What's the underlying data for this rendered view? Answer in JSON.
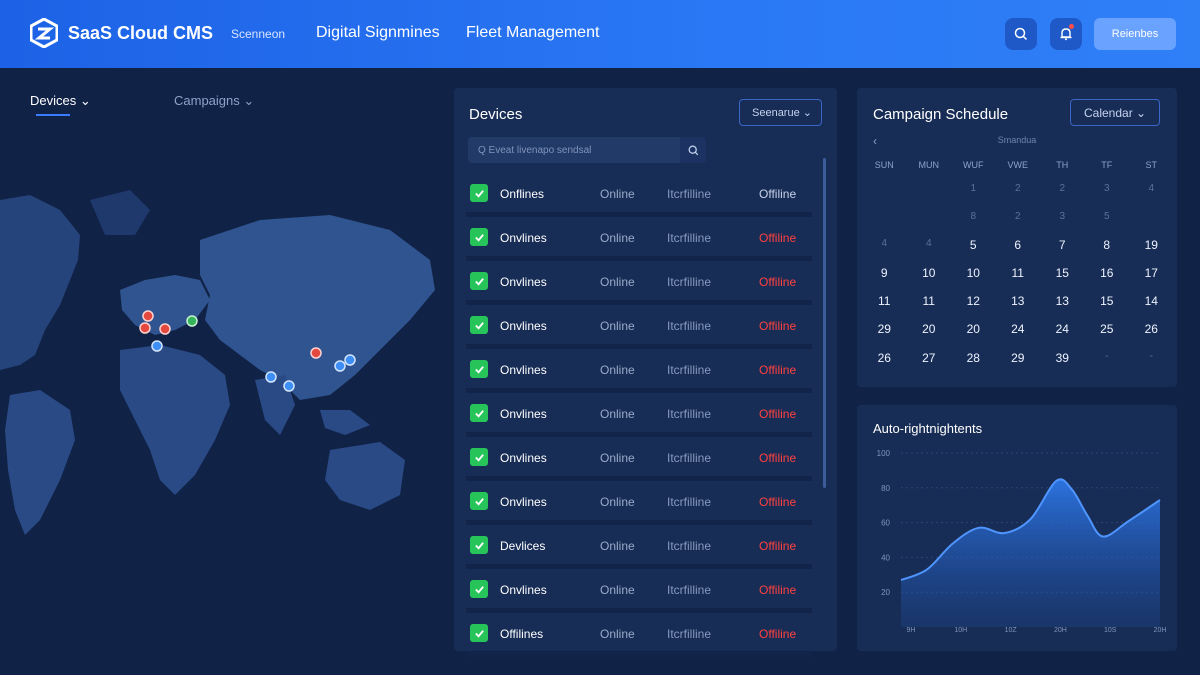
{
  "header": {
    "brand": "SaaS Cloud CMS",
    "nav": [
      "Scenneon",
      "Digital Signmines",
      "Fleet Management"
    ],
    "search_icon": "search-icon",
    "bell_icon": "bell-icon",
    "button_label": "Reienbes"
  },
  "left": {
    "tab_devices": "Devices ⌄",
    "tab_campaigns": "Campaigns ⌄",
    "markers": {
      "red": "#e5483f",
      "blue": "#3d8ef5",
      "green": "#35b45a"
    }
  },
  "devices": {
    "title": "Devices",
    "select_label": "Seenarue ⌄",
    "search_placeholder": "Q Eveat livenapo sendsal",
    "rows": [
      {
        "name": "Onflines",
        "col2": "Online",
        "col3": "Itcrfilline",
        "status": "Offiline",
        "red": false
      },
      {
        "name": "Onvlines",
        "col2": "Online",
        "col3": "Itcrfilline",
        "status": "Offiline",
        "red": true
      },
      {
        "name": "Onvlines",
        "col2": "Online",
        "col3": "Itcrfilline",
        "status": "Offiline",
        "red": true
      },
      {
        "name": "Onvlines",
        "col2": "Online",
        "col3": "Itcrfilline",
        "status": "Offiline",
        "red": true
      },
      {
        "name": "Onvlines",
        "col2": "Online",
        "col3": "Itcrfilline",
        "status": "Offiline",
        "red": true
      },
      {
        "name": "Onvlines",
        "col2": "Online",
        "col3": "Itcrfilline",
        "status": "Offiline",
        "red": true
      },
      {
        "name": "Onvlines",
        "col2": "Online",
        "col3": "Itcrfilline",
        "status": "Offiline",
        "red": true
      },
      {
        "name": "Onvlines",
        "col2": "Online",
        "col3": "Itcrfilline",
        "status": "Offiline",
        "red": true
      },
      {
        "name": "Devlices",
        "col2": "Online",
        "col3": "Itcrfilline",
        "status": "Offiline",
        "red": true
      },
      {
        "name": "Onvlines",
        "col2": "Online",
        "col3": "Itcrfilline",
        "status": "Offiline",
        "red": true
      },
      {
        "name": "Offilines",
        "col2": "Online",
        "col3": "Itcrfilline",
        "status": "Offiline",
        "red": true
      }
    ]
  },
  "calendar": {
    "title": "Campaign Schedule",
    "select_label": "Calendar ⌄",
    "prev": "‹",
    "month_label": "Smandua",
    "weekdays": [
      "SUN",
      "MUN",
      "WUF",
      "VWE",
      "TH",
      "TF",
      "ST"
    ],
    "weeks": [
      [
        "",
        "",
        "1",
        "2",
        "2",
        "3",
        "4"
      ],
      [
        "",
        "",
        "8",
        "2",
        "3",
        "5",
        ""
      ],
      [
        "4",
        "4",
        "5",
        "6",
        "7",
        "8",
        "19"
      ],
      [
        "9",
        "10",
        "10",
        "11",
        "15",
        "16",
        "17"
      ],
      [
        "11",
        "11",
        "12",
        "13",
        "13",
        "15",
        "14"
      ],
      [
        "29",
        "20",
        "20",
        "24",
        "24",
        "25",
        "26"
      ],
      [
        "26",
        "27",
        "28",
        "29",
        "39",
        "-",
        "-"
      ]
    ],
    "dim_cells": [
      "0-0",
      "0-1",
      "0-2",
      "0-3",
      "0-4",
      "0-5",
      "0-6",
      "1-2",
      "1-3",
      "1-4",
      "1-5",
      "2-0",
      "2-1",
      "6-5",
      "6-6"
    ]
  },
  "chart_data": {
    "type": "area",
    "title": "Auto-rightnightents",
    "x_ticks": [
      "9H",
      "10H",
      "10Z",
      "20H",
      "10S",
      "20H"
    ],
    "y_ticks": [
      20,
      40,
      60,
      80,
      100
    ],
    "ylim": [
      0,
      100
    ],
    "points": [
      {
        "x": 0,
        "y": 27
      },
      {
        "x": 0.5,
        "y": 33
      },
      {
        "x": 1.0,
        "y": 48
      },
      {
        "x": 1.5,
        "y": 57
      },
      {
        "x": 2.0,
        "y": 54
      },
      {
        "x": 2.5,
        "y": 62
      },
      {
        "x": 3.0,
        "y": 84
      },
      {
        "x": 3.3,
        "y": 79
      },
      {
        "x": 3.6,
        "y": 64
      },
      {
        "x": 3.9,
        "y": 52
      },
      {
        "x": 4.4,
        "y": 61
      },
      {
        "x": 5.0,
        "y": 73
      }
    ],
    "xlim": [
      0,
      5
    ],
    "color": "#2f7ff7"
  }
}
